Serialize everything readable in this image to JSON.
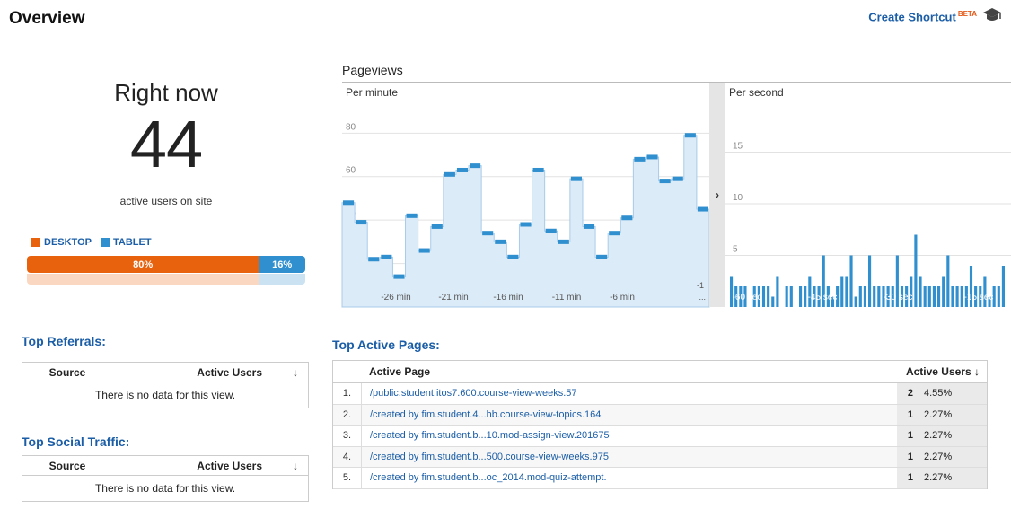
{
  "header": {
    "title": "Overview",
    "shortcut_label": "Create Shortcut",
    "beta_label": "BETA",
    "shortcut_icon": "graduation-cap-icon"
  },
  "right_now": {
    "title": "Right now",
    "count": "44",
    "subtitle": "active users on site",
    "legend": [
      {
        "label": "DESKTOP",
        "color": "#e8620e"
      },
      {
        "label": "TABLET",
        "color": "#2f8fcf"
      }
    ],
    "segments": [
      {
        "label": "80%",
        "value": 80,
        "color": "#e8620e"
      },
      {
        "label": "16%",
        "value": 16,
        "color": "#2f8fcf"
      }
    ]
  },
  "pageviews": {
    "title": "Pageviews",
    "per_minute_label": "Per minute",
    "per_second_label": "Per second",
    "splitter_glyph": "›"
  },
  "chart_data": [
    {
      "type": "area",
      "title": "Per minute",
      "ylim": [
        0,
        95
      ],
      "yticks": [
        "20",
        "40",
        "60",
        "80"
      ],
      "y_tick_values": [
        20,
        40,
        60,
        80
      ],
      "xticks": [
        "-26 min",
        "-21 min",
        "-16 min",
        "-11 min",
        "-6 min",
        "-1"
      ],
      "extra_label": "...",
      "values": [
        48,
        39,
        22,
        23,
        14,
        42,
        26,
        37,
        61,
        63,
        65,
        34,
        30,
        23,
        38,
        63,
        35,
        30,
        59,
        37,
        23,
        34,
        41,
        68,
        69,
        58,
        59,
        79,
        45
      ],
      "color": "#2f8fcf",
      "fill": "#dcebf8",
      "grid": true
    },
    {
      "type": "bar",
      "title": "Per second",
      "ylim": [
        0,
        20
      ],
      "yticks": [
        "5",
        "10",
        "15"
      ],
      "y_tick_values": [
        5,
        10,
        15
      ],
      "xticks": [
        "-60 sec",
        "-45 sec",
        "-30 sec",
        "-15 sec"
      ],
      "values": [
        3,
        2,
        2,
        2,
        0,
        2,
        2,
        2,
        2,
        1,
        3,
        0,
        2,
        2,
        0,
        2,
        2,
        3,
        2,
        2,
        5,
        2,
        1,
        2,
        3,
        3,
        5,
        1,
        2,
        2,
        5,
        2,
        2,
        2,
        2,
        2,
        5,
        2,
        2,
        3,
        7,
        3,
        2,
        2,
        2,
        2,
        3,
        5,
        2,
        2,
        2,
        2,
        4,
        2,
        2,
        3,
        1,
        2,
        2,
        4
      ],
      "color": "#2f8fcf",
      "grid": true
    }
  ],
  "top_referrals": {
    "title": "Top Referrals:",
    "col_source": "Source",
    "col_users": "Active Users",
    "sort_glyph": "↓",
    "empty_text": "There is no data for this view."
  },
  "top_social": {
    "title": "Top Social Traffic:",
    "col_source": "Source",
    "col_users": "Active Users",
    "sort_glyph": "↓",
    "empty_text": "There is no data for this view."
  },
  "top_pages": {
    "title": "Top Active Pages:",
    "col_page": "Active Page",
    "col_users": "Active Users",
    "sort_glyph": "↓",
    "rows": [
      {
        "idx": "1.",
        "page": "/public.student.itos7.600.course-view-weeks.57",
        "count": "2",
        "pct": "4.55%"
      },
      {
        "idx": "2.",
        "page": "/created by fim.student.4...hb.course-view-topics.164",
        "count": "1",
        "pct": "2.27%"
      },
      {
        "idx": "3.",
        "page": "/created by fim.student.b...10.mod-assign-view.201675",
        "count": "1",
        "pct": "2.27%"
      },
      {
        "idx": "4.",
        "page": "/created by fim.student.b...500.course-view-weeks.975",
        "count": "1",
        "pct": "2.27%"
      },
      {
        "idx": "5.",
        "page": "/created by fim.student.b...oc_2014.mod-quiz-attempt.",
        "count": "1",
        "pct": "2.27%"
      }
    ]
  }
}
